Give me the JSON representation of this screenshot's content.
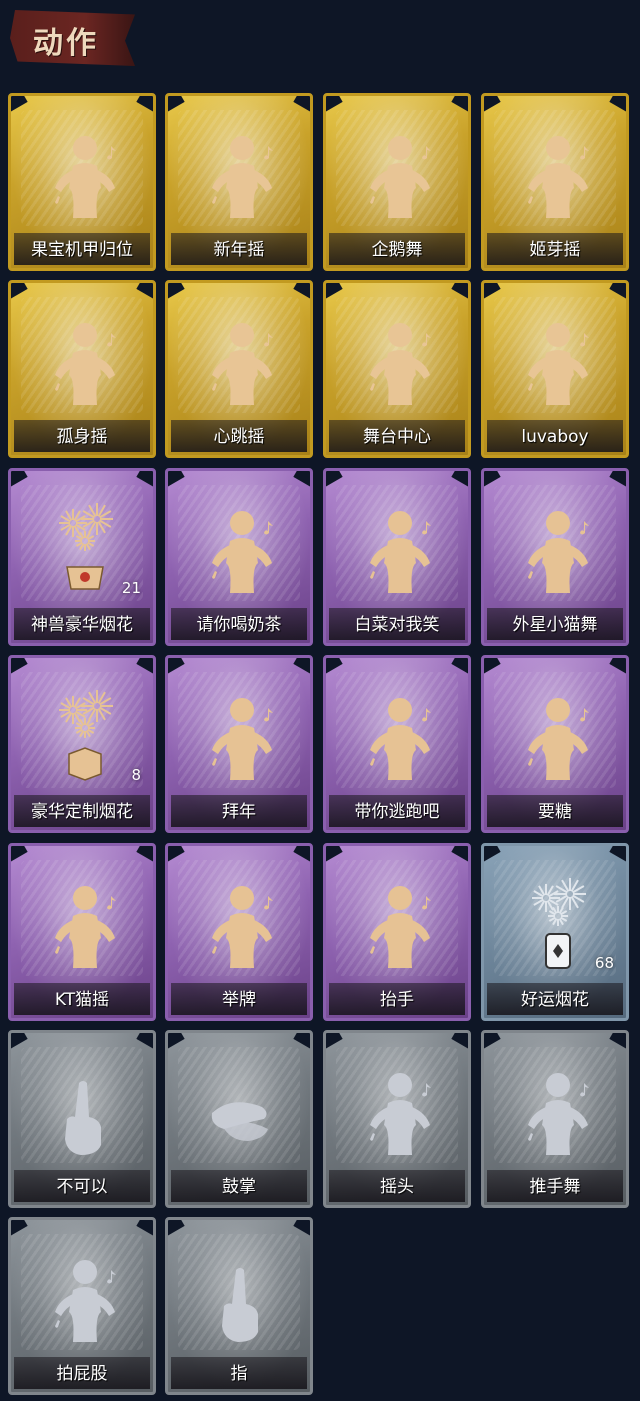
{
  "header": {
    "title": "动作"
  },
  "cards": [
    {
      "label": "果宝机甲归位",
      "rarity": "gold",
      "icon": "figure-flex-icon"
    },
    {
      "label": "新年摇",
      "rarity": "gold",
      "icon": "figure-clap-icon"
    },
    {
      "label": "企鹅舞",
      "rarity": "gold",
      "icon": "figure-penguin-icon"
    },
    {
      "label": "姬芽摇",
      "rarity": "gold",
      "icon": "figure-wave-icon"
    },
    {
      "label": "孤身摇",
      "rarity": "gold",
      "icon": "figure-dance-icon"
    },
    {
      "label": "心跳摇",
      "rarity": "gold",
      "icon": "figure-raise-hand-icon"
    },
    {
      "label": "舞台中心",
      "rarity": "gold",
      "icon": "figure-pose-icon"
    },
    {
      "label": "luvaboy",
      "rarity": "gold",
      "icon": "figure-sway-icon"
    },
    {
      "label": "神兽豪华烟花",
      "rarity": "purple",
      "icon": "firework-pot-icon",
      "count": "21"
    },
    {
      "label": "请你喝奶茶",
      "rarity": "purple",
      "icon": "figure-sign-icon"
    },
    {
      "label": "白菜对我笑",
      "rarity": "purple",
      "icon": "figure-cross-arms-icon"
    },
    {
      "label": "外星小猫舞",
      "rarity": "purple",
      "icon": "figure-cat-dance-icon"
    },
    {
      "label": "豪华定制烟花",
      "rarity": "purple",
      "icon": "firework-box-icon",
      "count": "8"
    },
    {
      "label": "拜年",
      "rarity": "purple",
      "icon": "figure-bow-icon"
    },
    {
      "label": "带你逃跑吧",
      "rarity": "purple",
      "icon": "figure-point-icon"
    },
    {
      "label": "要糖",
      "rarity": "purple",
      "icon": "figure-reach-icon"
    },
    {
      "label": "KT猫摇",
      "rarity": "purple",
      "icon": "figure-music-icon"
    },
    {
      "label": "举牌",
      "rarity": "purple",
      "icon": "figure-hold-sign-icon"
    },
    {
      "label": "抬手",
      "rarity": "purple",
      "icon": "figure-lift-hand-icon"
    },
    {
      "label": "好运烟花",
      "rarity": "blue",
      "icon": "firework-can-icon",
      "count": "68"
    },
    {
      "label": "不可以",
      "rarity": "gray",
      "icon": "finger-wag-icon"
    },
    {
      "label": "鼓掌",
      "rarity": "gray",
      "icon": "hands-clap-icon"
    },
    {
      "label": "摇头",
      "rarity": "gray",
      "icon": "figure-shake-head-icon"
    },
    {
      "label": "推手舞",
      "rarity": "gray",
      "icon": "figure-push-hands-icon"
    },
    {
      "label": "拍屁股",
      "rarity": "gray",
      "icon": "figure-pat-icon"
    },
    {
      "label": "指",
      "rarity": "gray",
      "icon": "hand-point-icon"
    }
  ]
}
